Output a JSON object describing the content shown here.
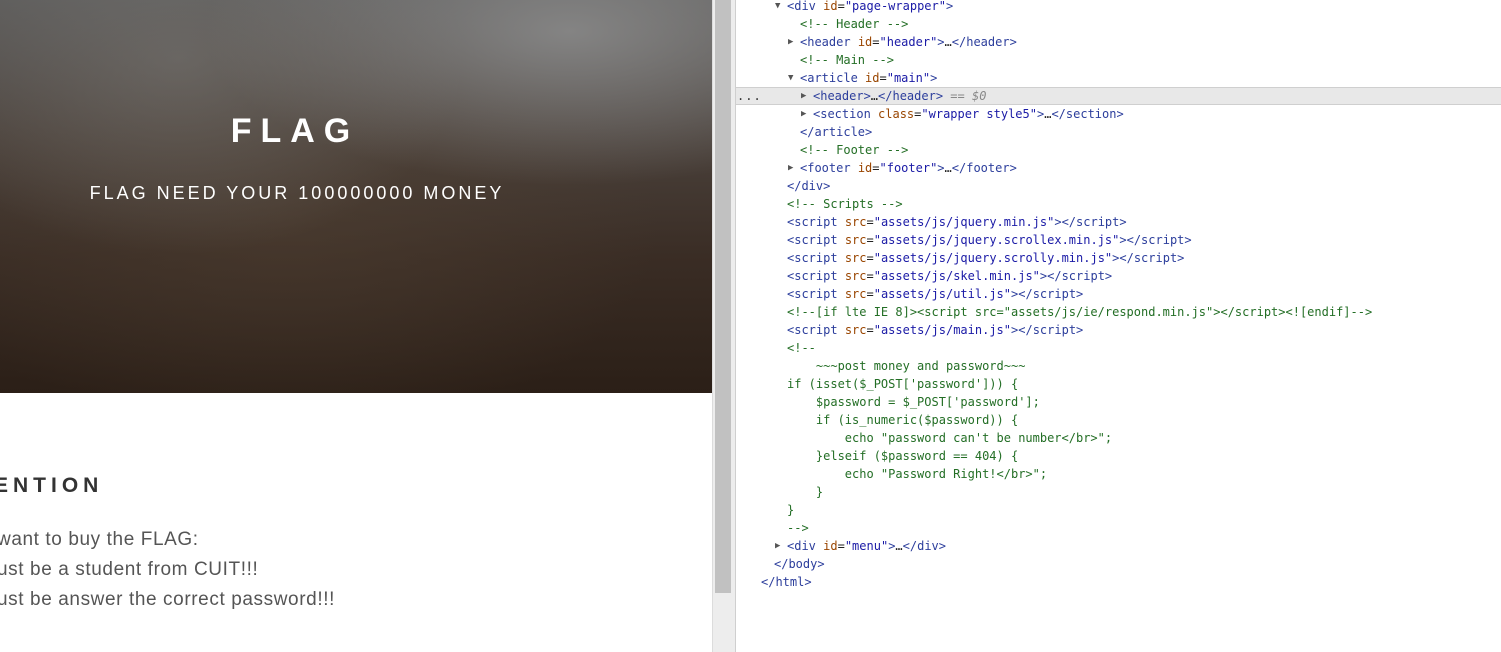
{
  "page": {
    "banner_title": "FLAG",
    "banner_subtitle": "FLAG NEED YOUR 100000000 MONEY",
    "section_heading": "ENTION",
    "lines": [
      "want to buy the FLAG:",
      "ust be a student from CUIT!!!",
      "ust be answer the correct password!!!"
    ]
  },
  "devtools": {
    "selected_ellipsis": "...",
    "dom_lines": [
      {
        "indent": 1,
        "tri": "▼",
        "html": "<span class='tagb'>&lt;div</span> <span class='attr'>id</span>=<span class='val'>\"page-wrapper\"</span><span class='tagb'>&gt;</span>"
      },
      {
        "indent": 2,
        "tri": "",
        "html": "<span class='cmt'>&lt;!-- Header --&gt;</span>"
      },
      {
        "indent": 2,
        "tri": "▶",
        "html": "<span class='tagb'>&lt;header</span> <span class='attr'>id</span>=<span class='val'>\"header\"</span><span class='tagb'>&gt;</span>…<span class='tagb'>&lt;/header&gt;</span>"
      },
      {
        "indent": 2,
        "tri": "",
        "html": "<span class='cmt'>&lt;!-- Main --&gt;</span>"
      },
      {
        "indent": 2,
        "tri": "▼",
        "html": "<span class='tagb'>&lt;article</span> <span class='attr'>id</span>=<span class='val'>\"main\"</span><span class='tagb'>&gt;</span>"
      },
      {
        "indent": 3,
        "tri": "▶",
        "selected": true,
        "html": "<span class='tagb'>&lt;header&gt;</span>…<span class='tagb'>&lt;/header&gt;</span> <span class='dim'>== $0</span>"
      },
      {
        "indent": 3,
        "tri": "▶",
        "html": "<span class='tagb'>&lt;section</span> <span class='attr'>class</span>=<span class='val'>\"wrapper style5\"</span><span class='tagb'>&gt;</span>…<span class='tagb'>&lt;/section&gt;</span>"
      },
      {
        "indent": 2,
        "tri": "",
        "html": "<span class='tagb'>&lt;/article&gt;</span>"
      },
      {
        "indent": 2,
        "tri": "",
        "html": "<span class='cmt'>&lt;!-- Footer --&gt;</span>"
      },
      {
        "indent": 2,
        "tri": "▶",
        "html": "<span class='tagb'>&lt;footer</span> <span class='attr'>id</span>=<span class='val'>\"footer\"</span><span class='tagb'>&gt;</span>…<span class='tagb'>&lt;/footer&gt;</span>"
      },
      {
        "indent": 1,
        "tri": "",
        "html": "<span class='tagb'>&lt;/div&gt;</span>"
      },
      {
        "indent": 1,
        "tri": "",
        "html": "<span class='cmt'>&lt;!-- Scripts --&gt;</span>"
      },
      {
        "indent": 1,
        "tri": "",
        "html": "<span class='tagb'>&lt;script</span> <span class='attr'>src</span>=<span class='val'>\"assets/js/jquery.min.js\"</span><span class='tagb'>&gt;&lt;/script&gt;</span>"
      },
      {
        "indent": 1,
        "tri": "",
        "html": "<span class='tagb'>&lt;script</span> <span class='attr'>src</span>=<span class='val'>\"assets/js/jquery.scrollex.min.js\"</span><span class='tagb'>&gt;&lt;/script&gt;</span>"
      },
      {
        "indent": 1,
        "tri": "",
        "html": "<span class='tagb'>&lt;script</span> <span class='attr'>src</span>=<span class='val'>\"assets/js/jquery.scrolly.min.js\"</span><span class='tagb'>&gt;&lt;/script&gt;</span>"
      },
      {
        "indent": 1,
        "tri": "",
        "html": "<span class='tagb'>&lt;script</span> <span class='attr'>src</span>=<span class='val'>\"assets/js/skel.min.js\"</span><span class='tagb'>&gt;&lt;/script&gt;</span>"
      },
      {
        "indent": 1,
        "tri": "",
        "html": "<span class='tagb'>&lt;script</span> <span class='attr'>src</span>=<span class='val'>\"assets/js/util.js\"</span><span class='tagb'>&gt;&lt;/script&gt;</span>"
      },
      {
        "indent": 1,
        "tri": "",
        "html": "<span class='cmt'>&lt;!--[if lte IE 8]&gt;&lt;script src=\"assets/js/ie/respond.min.js\"&gt;&lt;/script&gt;&lt;![endif]--&gt;</span>"
      },
      {
        "indent": 1,
        "tri": "",
        "html": "<span class='tagb'>&lt;script</span> <span class='attr'>src</span>=<span class='val'>\"assets/js/main.js\"</span><span class='tagb'>&gt;&lt;/script&gt;</span>"
      },
      {
        "indent": 1,
        "tri": "",
        "html": "<span class='cmt'>&lt;!--</span>"
      },
      {
        "indent": 1,
        "tri": "",
        "html": "<span class='cmt'>    ~~~post money and password~~~</span>"
      },
      {
        "indent": 1,
        "tri": "",
        "html": "<span class='cmt'>if (isset($_POST['password'])) {</span>"
      },
      {
        "indent": 1,
        "tri": "",
        "html": "<span class='cmt'>    $password = $_POST['password'];</span>"
      },
      {
        "indent": 1,
        "tri": "",
        "html": "<span class='cmt'>    if (is_numeric($password)) {</span>"
      },
      {
        "indent": 1,
        "tri": "",
        "html": "<span class='cmt'>        echo \"password can't be number&lt;/br&gt;\";</span>"
      },
      {
        "indent": 1,
        "tri": "",
        "html": "<span class='cmt'>    }elseif ($password == 404) {</span>"
      },
      {
        "indent": 1,
        "tri": "",
        "html": "<span class='cmt'>        echo \"Password Right!&lt;/br&gt;\";</span>"
      },
      {
        "indent": 1,
        "tri": "",
        "html": "<span class='cmt'>    }</span>"
      },
      {
        "indent": 1,
        "tri": "",
        "html": "<span class='cmt'>}</span>"
      },
      {
        "indent": 1,
        "tri": "",
        "html": "<span class='cmt'>--&gt;</span>"
      },
      {
        "indent": 1,
        "tri": "▶",
        "html": "<span class='tagb'>&lt;div</span> <span class='attr'>id</span>=<span class='val'>\"menu\"</span><span class='tagb'>&gt;</span>…<span class='tagb'>&lt;/div&gt;</span>"
      },
      {
        "indent": 0,
        "tri": "",
        "html": "<span class='tagb'>&lt;/body&gt;</span>"
      },
      {
        "indent": -1,
        "tri": "",
        "html": "<span class='tagb'>&lt;/html&gt;</span>"
      }
    ]
  }
}
